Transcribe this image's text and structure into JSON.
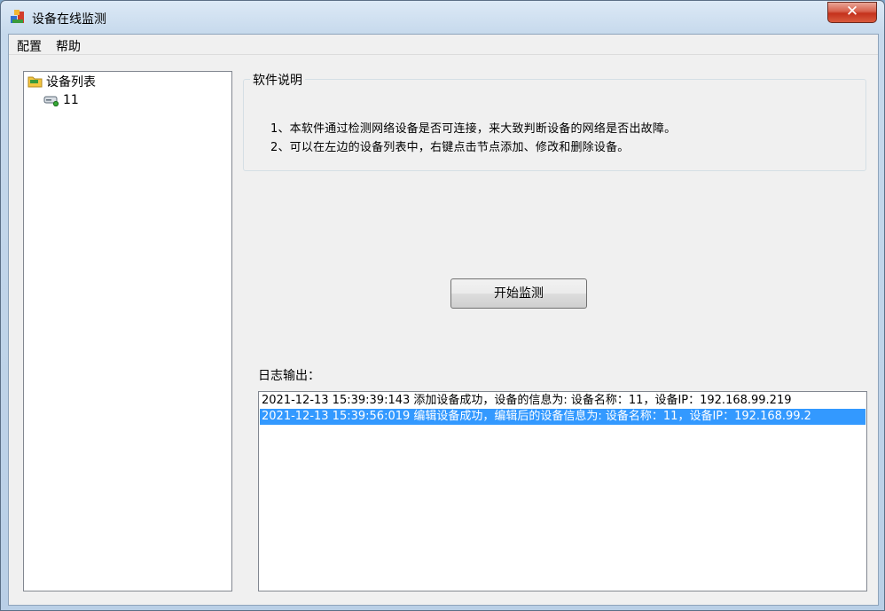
{
  "window": {
    "title": "设备在线监测",
    "close_glyph": "✕"
  },
  "menu": {
    "items": [
      "配置",
      "帮助"
    ]
  },
  "tree": {
    "root_label": "设备列表",
    "root_icon": "folder-icon",
    "children": [
      {
        "label": "11",
        "icon": "network-drive-icon"
      }
    ]
  },
  "description": {
    "title": "软件说明",
    "lines": [
      "1、本软件通过检测网络设备是否可连接，来大致判断设备的网络是否出故障。",
      "2、可以在左边的设备列表中，右键点击节点添加、修改和删除设备。"
    ]
  },
  "start_button": {
    "label": "开始监测"
  },
  "log": {
    "label": "日志输出：",
    "lines": [
      {
        "text": "2021-12-13 15:39:39:143  添加设备成功，设备的信息为: 设备名称：11，设备IP：192.168.99.219",
        "selected": false
      },
      {
        "text": "2021-12-13 15:39:56:019  编辑设备成功，编辑后的设备信息为: 设备名称：11，设备IP：192.168.99.2",
        "selected": true
      }
    ]
  },
  "colors": {
    "selection": "#3399ff",
    "close_button": "#c4311c"
  }
}
